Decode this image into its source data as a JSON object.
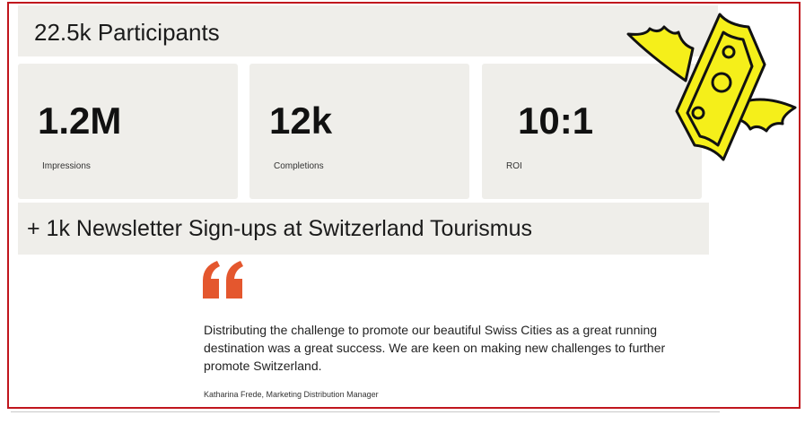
{
  "participants": "22.5k Participants",
  "metrics": [
    {
      "value": "1.2M",
      "label": "Impressions"
    },
    {
      "value": "12k",
      "label": "Completions"
    },
    {
      "value": "10:1",
      "label": "ROI"
    }
  ],
  "newsletter": "+ 1k Newsletter Sign-ups at Switzerland Tourismus",
  "testimonial": {
    "quote": "Distributing the challenge to promote our beautiful Swiss Cities as a great running destination was a great success. We are keen on making new challenges to further promote Switzerland.",
    "author": "Katharina Frede, Marketing Distribution Manager"
  },
  "colors": {
    "accent": "#e4572e",
    "frame": "#c0161d",
    "money": "#f5ef1a",
    "panel": "#efeeea"
  },
  "icons": {
    "quote": "quote-mark-icon",
    "flying_money": "flying-money-icon"
  }
}
